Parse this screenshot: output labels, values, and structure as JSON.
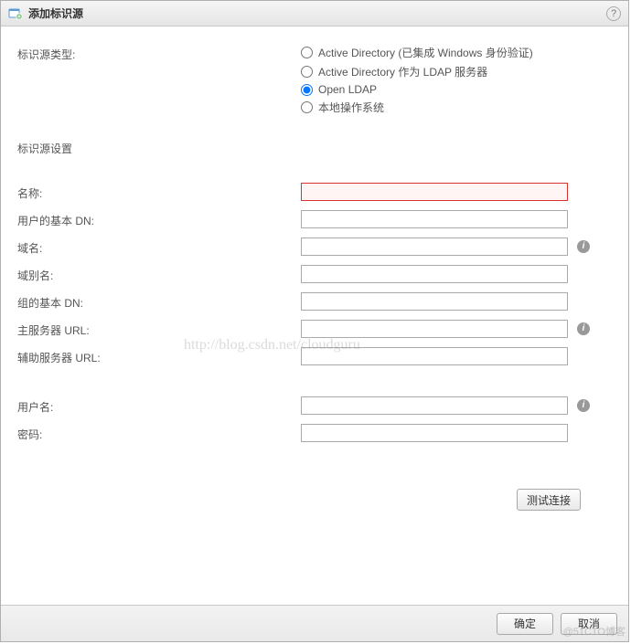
{
  "dialog": {
    "title": "添加标识源",
    "help_tooltip": "帮助"
  },
  "form": {
    "type_label": "标识源类型:",
    "type_options": [
      {
        "label": "Active Directory (已集成 Windows 身份验证)",
        "value": "ad_iwa",
        "selected": false
      },
      {
        "label": "Active Directory 作为 LDAP 服务器",
        "value": "ad_ldap",
        "selected": false
      },
      {
        "label": "Open LDAP",
        "value": "openldap",
        "selected": true
      },
      {
        "label": "本地操作系统",
        "value": "localos",
        "selected": false
      }
    ],
    "settings_label": "标识源设置",
    "fields": {
      "name": {
        "label": "名称:",
        "value": "",
        "error": true
      },
      "user_dn": {
        "label": "用户的基本 DN:",
        "value": ""
      },
      "domain": {
        "label": "域名:",
        "value": "",
        "info": true
      },
      "alias": {
        "label": "域别名:",
        "value": ""
      },
      "group_dn": {
        "label": "组的基本 DN:",
        "value": ""
      },
      "primary": {
        "label": "主服务器 URL:",
        "value": "",
        "info": true
      },
      "secondary": {
        "label": "辅助服务器 URL:",
        "value": ""
      },
      "username": {
        "label": "用户名:",
        "value": "",
        "info": true
      },
      "password": {
        "label": "密码:",
        "value": ""
      }
    },
    "test_button": "测试连接"
  },
  "buttons": {
    "ok": "确定",
    "cancel": "取消"
  },
  "watermark": "http://blog.csdn.net/cloudguru",
  "watermark2": "@51CTO博客"
}
